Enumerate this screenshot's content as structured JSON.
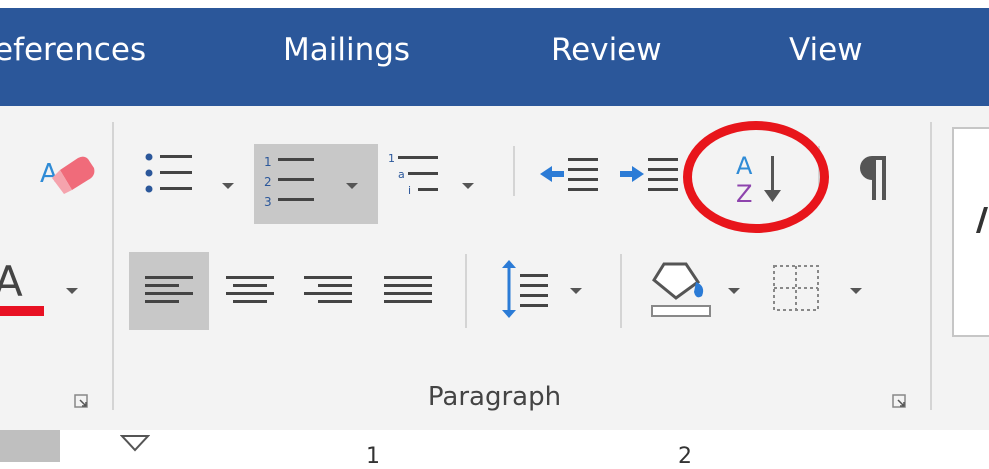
{
  "heading_fragment": "",
  "tabs": [
    "eferences",
    "Mailings",
    "Review",
    "View",
    ""
  ],
  "group": {
    "label": "Paragraph"
  },
  "ruler": {
    "marks": [
      "1",
      "2"
    ]
  },
  "colors": {
    "tab_bar": "#2b579a",
    "highlight": "#e8151b",
    "font_color_bar": "#e81123",
    "sort_a": "#2f8bd6",
    "sort_z": "#8e44ad"
  },
  "icons": [
    "eraser-icon",
    "bullets-icon",
    "numbering-icon",
    "multilevel-list-icon",
    "decrease-indent-icon",
    "increase-indent-icon",
    "sort-icon",
    "pilcrow-icon",
    "font-color-icon",
    "align-left-icon",
    "align-center-icon",
    "align-right-icon",
    "justify-icon",
    "line-spacing-icon",
    "shading-icon",
    "borders-icon"
  ]
}
